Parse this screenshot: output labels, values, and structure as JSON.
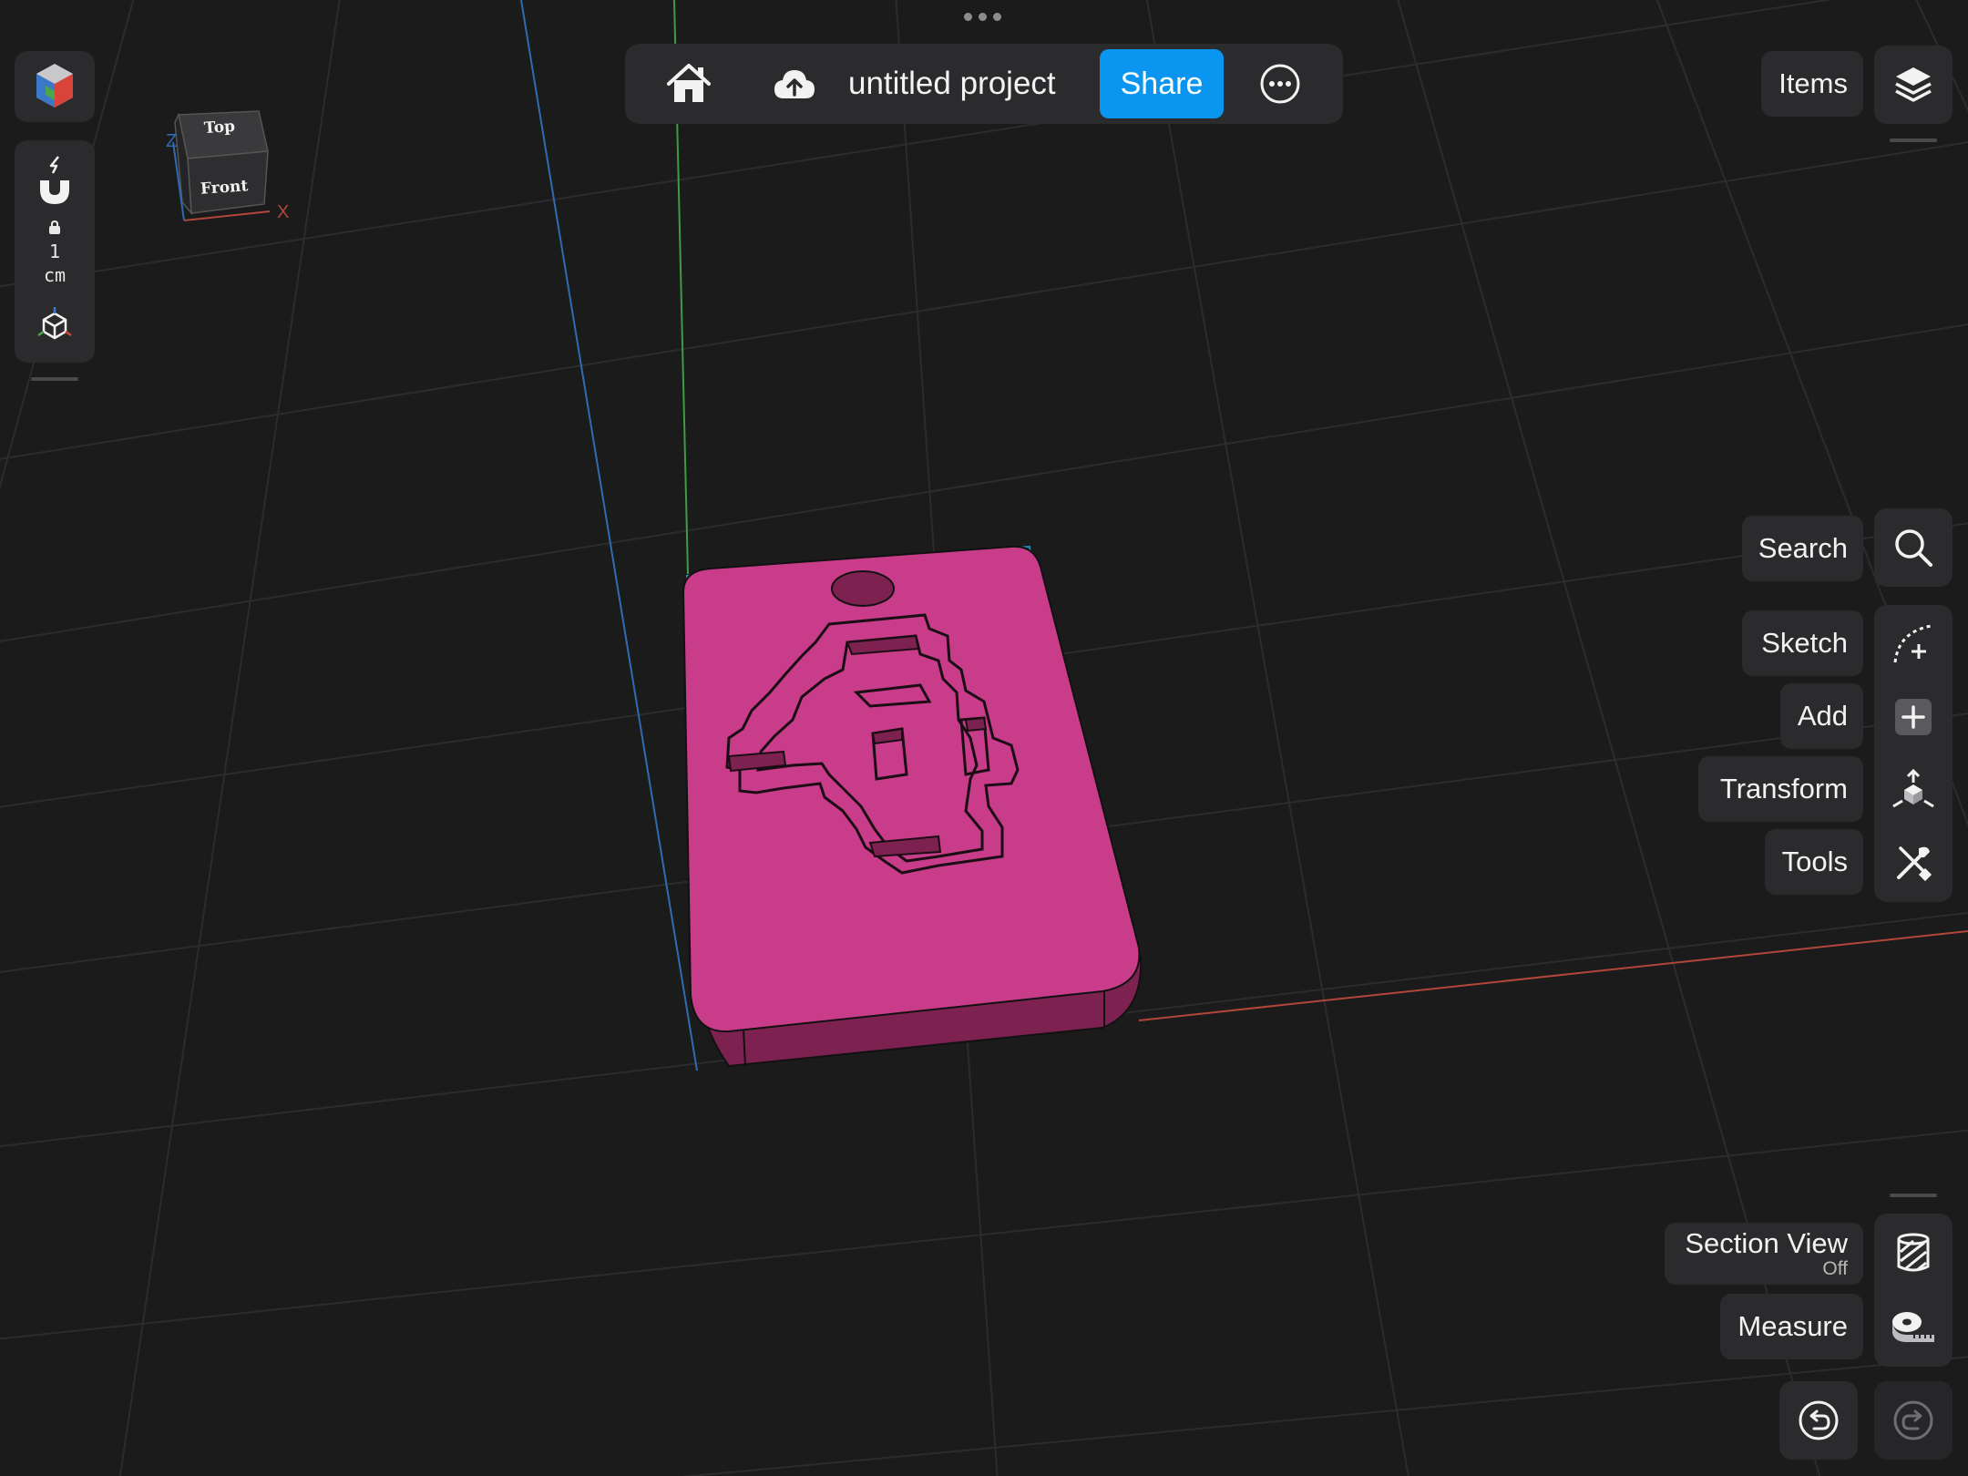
{
  "topbar": {
    "project_title": "untitled project",
    "share_label": "Share"
  },
  "left_toolbar": {
    "grid_value": "1",
    "grid_unit": "cm"
  },
  "view_cube": {
    "top_label": "Top",
    "front_label": "Front",
    "axis_x": "X",
    "axis_z": "Z"
  },
  "right_toolbar": {
    "items_label": "Items",
    "search_label": "Search",
    "sketch_label": "Sketch",
    "add_label": "Add",
    "transform_label": "Transform",
    "tools_label": "Tools",
    "section_view_label": "Section View",
    "section_view_status": "Off",
    "measure_label": "Measure"
  },
  "colors": {
    "accent": "#0a96f0",
    "model": "#c83c8a",
    "model_side": "#7d2250",
    "background": "#1b1b1c",
    "panel": "#2b2b2d",
    "axis_x": "#b2463a",
    "axis_y": "#3f9a45",
    "axis_z": "#2f6bb0"
  }
}
